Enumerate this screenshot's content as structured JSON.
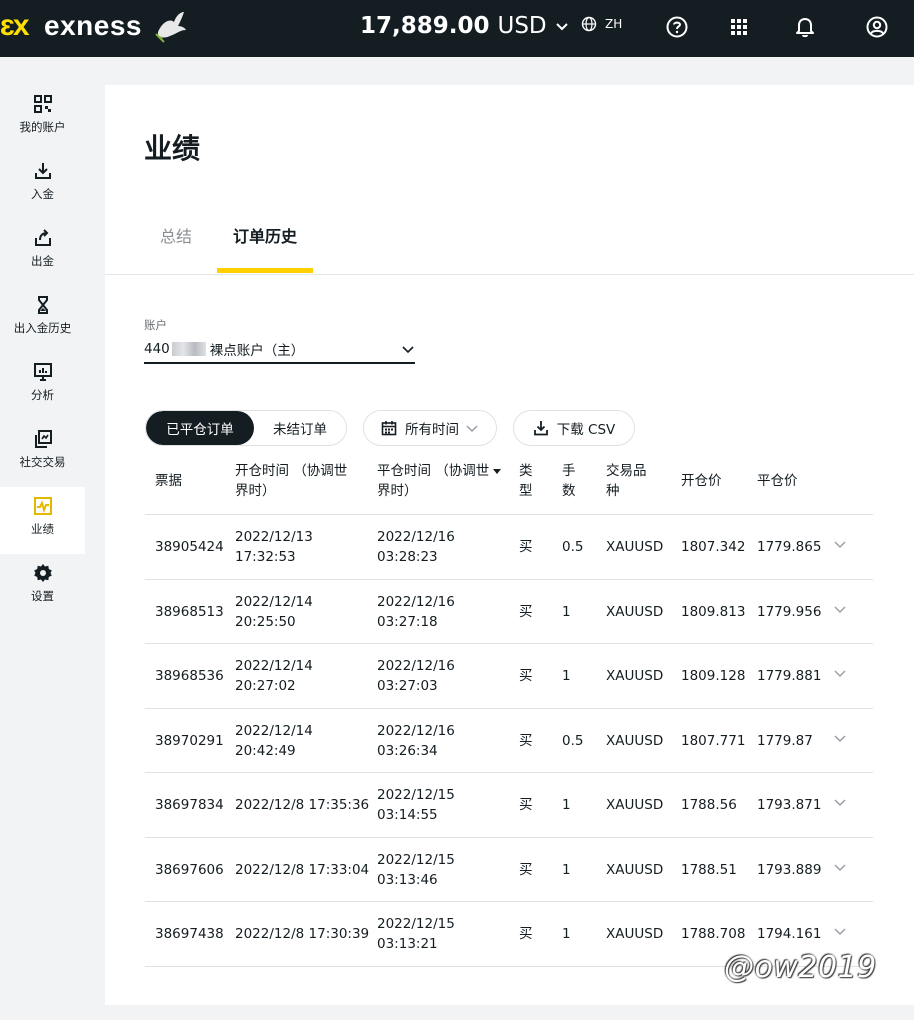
{
  "topbar": {
    "brand": "exness",
    "balance_amount": "17,889.00",
    "balance_currency": "USD",
    "language": "ZH"
  },
  "sidebar": {
    "items": [
      {
        "label": "我的账户",
        "icon": "grid-qr-icon"
      },
      {
        "label": "入金",
        "icon": "download-icon"
      },
      {
        "label": "出金",
        "icon": "upload-icon"
      },
      {
        "label": "出入金历史",
        "icon": "hourglass-icon"
      },
      {
        "label": "分析",
        "icon": "presentation-chart-icon"
      },
      {
        "label": "社交交易",
        "icon": "copy-icon"
      },
      {
        "label": "业绩",
        "icon": "pulse-chart-icon",
        "active": true
      },
      {
        "label": "设置",
        "icon": "gear-icon"
      }
    ]
  },
  "page": {
    "title": "业绩",
    "tabs": [
      "总结",
      "订单历史"
    ],
    "active_tab": "订单历史"
  },
  "account": {
    "label": "账户",
    "value_prefix": "440",
    "value_suffix": "裸点账户（主）"
  },
  "filters": {
    "closed_orders": "已平仓订单",
    "open_orders": "未结订单",
    "time_range": "所有时间",
    "download": "下载 CSV"
  },
  "table": {
    "headers": [
      "票据",
      "开仓时间 （协调世界时）",
      "平仓时间 （协调世界时）",
      "类型",
      "手数",
      "交易品种",
      "开仓价",
      "平仓价"
    ],
    "header_lines": {
      "ticket": "票据",
      "open_time_1": "开仓时间 （协调世",
      "open_time_2": "界时）",
      "close_time_1": "平仓时间 （协调世",
      "close_time_2": "界时）",
      "type_1": "类",
      "type_2": "型",
      "lots_1": "手",
      "lots_2": "数",
      "symbol_1": "交易品",
      "symbol_2": "种",
      "open_price": "开仓价",
      "close_price": "平仓价"
    },
    "rows": [
      {
        "ticket": "38905424",
        "open_1": "2022/12/13",
        "open_2": "17:32:53",
        "close_1": "2022/12/16",
        "close_2": "03:28:23",
        "type": "买",
        "lots": "0.5",
        "symbol": "XAUUSD",
        "open_price": "1807.342",
        "close_price": "1779.865"
      },
      {
        "ticket": "38968513",
        "open_1": "2022/12/14",
        "open_2": "20:25:50",
        "close_1": "2022/12/16",
        "close_2": "03:27:18",
        "type": "买",
        "lots": "1",
        "symbol": "XAUUSD",
        "open_price": "1809.813",
        "close_price": "1779.956"
      },
      {
        "ticket": "38968536",
        "open_1": "2022/12/14",
        "open_2": "20:27:02",
        "close_1": "2022/12/16",
        "close_2": "03:27:03",
        "type": "买",
        "lots": "1",
        "symbol": "XAUUSD",
        "open_price": "1809.128",
        "close_price": "1779.881"
      },
      {
        "ticket": "38970291",
        "open_1": "2022/12/14",
        "open_2": "20:42:49",
        "close_1": "2022/12/16",
        "close_2": "03:26:34",
        "type": "买",
        "lots": "0.5",
        "symbol": "XAUUSD",
        "open_price": "1807.771",
        "close_price": "1779.87"
      },
      {
        "ticket": "38697834",
        "open_1": "2022/12/8 17:35:36",
        "open_2": "",
        "close_1": "2022/12/15",
        "close_2": "03:14:55",
        "type": "买",
        "lots": "1",
        "symbol": "XAUUSD",
        "open_price": "1788.56",
        "close_price": "1793.871"
      },
      {
        "ticket": "38697606",
        "open_1": "2022/12/8 17:33:04",
        "open_2": "",
        "close_1": "2022/12/15",
        "close_2": "03:13:46",
        "type": "买",
        "lots": "1",
        "symbol": "XAUUSD",
        "open_price": "1788.51",
        "close_price": "1793.889"
      },
      {
        "ticket": "38697438",
        "open_1": "2022/12/8 17:30:39",
        "open_2": "",
        "close_1": "2022/12/15",
        "close_2": "03:13:21",
        "type": "买",
        "lots": "1",
        "symbol": "XAUUSD",
        "open_price": "1788.708",
        "close_price": "1794.161"
      }
    ]
  },
  "watermark": "@ow2019",
  "colors": {
    "topbar_bg": "#141d22",
    "accent_yellow": "#ffcf00",
    "page_bg": "#f2f3f5"
  }
}
